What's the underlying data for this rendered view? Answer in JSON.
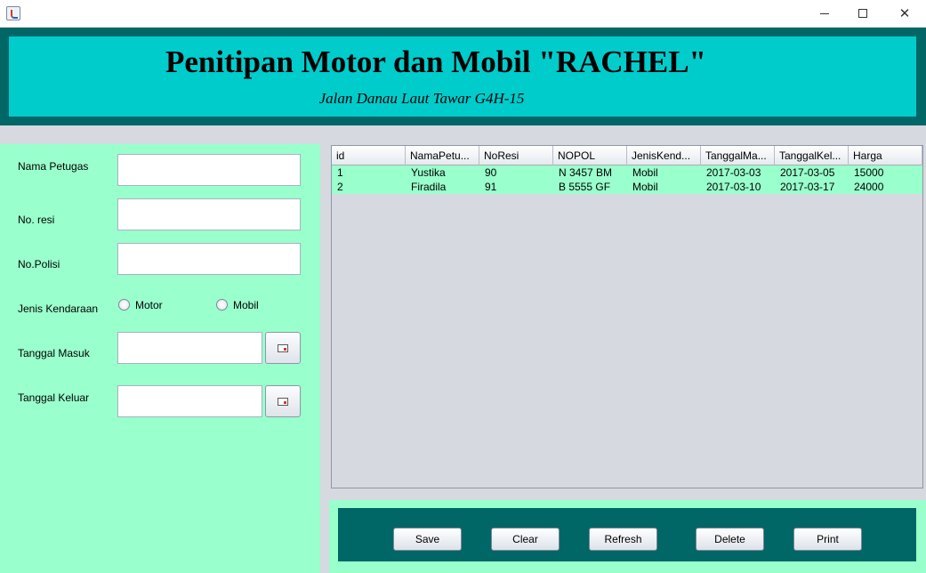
{
  "window": {
    "close_glyph": "✕"
  },
  "header": {
    "title": "Penitipan Motor dan Mobil \"RACHEL\"",
    "subtitle": "Jalan Danau Laut Tawar G4H-15"
  },
  "form": {
    "nama_petugas_label": "Nama Petugas",
    "no_resi_label": "No. resi",
    "no_polisi_label": "No.Polisi",
    "jenis_kendaraan_label": "Jenis Kendaraan",
    "radio_motor_label": "Motor",
    "radio_mobil_label": "Mobil",
    "tanggal_masuk_label": "Tanggal Masuk",
    "tanggal_keluar_label": "Tanggal Keluar",
    "nama_petugas_value": "",
    "no_resi_value": "",
    "no_polisi_value": "",
    "tanggal_masuk_value": "",
    "tanggal_keluar_value": ""
  },
  "table": {
    "columns": [
      "id",
      "NamaPetu...",
      "NoResi",
      "NOPOL",
      "JenisKend...",
      "TanggalMa...",
      "TanggalKel...",
      "Harga"
    ],
    "rows": [
      [
        "1",
        "Yustika",
        "90",
        "N 3457 BM",
        "Mobil",
        "2017-03-03",
        "2017-03-05",
        "15000"
      ],
      [
        "2",
        "Firadila",
        "91",
        "B 5555 GF",
        "Mobil",
        "2017-03-10",
        "2017-03-17",
        "24000"
      ]
    ]
  },
  "buttons": {
    "save": "Save",
    "clear": "Clear",
    "refresh": "Refresh",
    "delete": "Delete",
    "print": "Print"
  },
  "colors": {
    "header_outer": "#006666",
    "header_inner": "#00cccc",
    "panel": "#99ffcc"
  }
}
